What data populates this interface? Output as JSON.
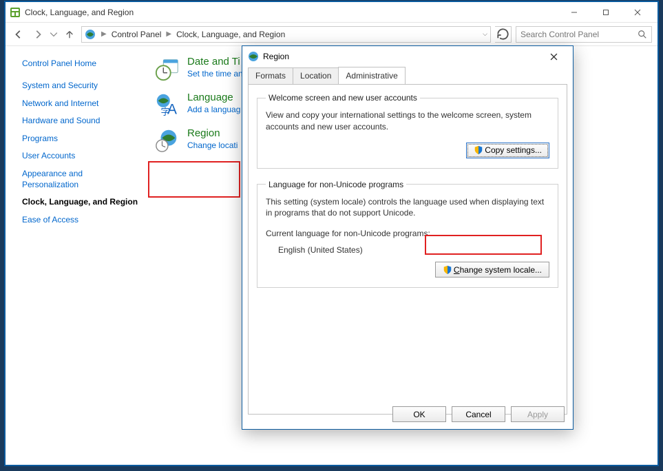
{
  "window": {
    "title": "Clock, Language, and Region",
    "breadcrumb": [
      "Control Panel",
      "Clock, Language, and Region"
    ],
    "search_placeholder": "Search Control Panel"
  },
  "sidebar": {
    "home": "Control Panel Home",
    "items": [
      {
        "label": "System and Security"
      },
      {
        "label": "Network and Internet"
      },
      {
        "label": "Hardware and Sound"
      },
      {
        "label": "Programs"
      },
      {
        "label": "User Accounts"
      },
      {
        "label": "Appearance and Personalization"
      },
      {
        "label": "Clock, Language, and Region",
        "current": true
      },
      {
        "label": "Ease of Access"
      }
    ]
  },
  "categories": [
    {
      "title": "Date and Ti",
      "sub": "Set the time an"
    },
    {
      "title": "Language",
      "sub": "Add a languag"
    },
    {
      "title": "Region",
      "sub": "Change locati"
    }
  ],
  "dialog": {
    "title": "Region",
    "tabs": [
      "Formats",
      "Location",
      "Administrative"
    ],
    "active_tab": 2,
    "group1": {
      "legend": "Welcome screen and new user accounts",
      "desc": "View and copy your international settings to the welcome screen, system accounts and new user accounts.",
      "button": "Copy settings..."
    },
    "group2": {
      "legend": "Language for non-Unicode programs",
      "desc": "This setting (system locale) controls the language used when displaying text in programs that do not support Unicode.",
      "label": "Current language for non-Unicode programs:",
      "value": "English (United States)",
      "button": "Change system locale..."
    },
    "buttons": {
      "ok": "OK",
      "cancel": "Cancel",
      "apply": "Apply"
    }
  }
}
